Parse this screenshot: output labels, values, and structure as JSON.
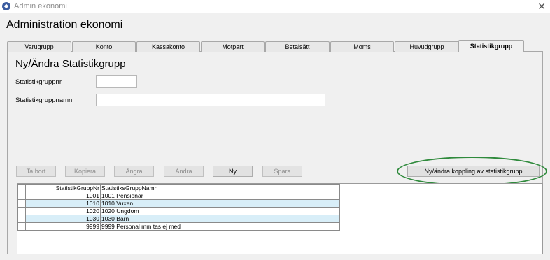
{
  "window": {
    "title": "Admin ekonomi",
    "close_symbol": "✕",
    "app_icon": "app-logo-icon"
  },
  "header": {
    "title": "Administration ekonomi"
  },
  "tabs": [
    {
      "label": "Varugrupp",
      "active": false
    },
    {
      "label": "Konto",
      "active": false
    },
    {
      "label": "Kassakonto",
      "active": false
    },
    {
      "label": "Motpart",
      "active": false
    },
    {
      "label": "Betalsätt",
      "active": false
    },
    {
      "label": "Moms",
      "active": false
    },
    {
      "label": "Huvudgrupp",
      "active": false
    },
    {
      "label": "Statistikgrupp",
      "active": true
    }
  ],
  "form": {
    "title": "Ny/Ändra Statistikgrupp",
    "nr_label": "Statistikgruppnr",
    "nr_value": "",
    "name_label": "Statistikgruppnamn",
    "name_value": ""
  },
  "buttons": {
    "delete": "Ta bort",
    "copy": "Kopiera",
    "undo": "Ångra",
    "edit": "Ändra",
    "new": "Ny",
    "save": "Spara",
    "link": "Ny/ändra koppling av statistikgrupp"
  },
  "annotation": {
    "color": "#2f8a3c"
  },
  "grid": {
    "columns": [
      "StatistikGruppNr",
      "StatistiksGruppNamn"
    ],
    "rows": [
      {
        "nr": "1001",
        "name": "1001 Pensionär"
      },
      {
        "nr": "1010",
        "name": "1010 Vuxen"
      },
      {
        "nr": "1020",
        "name": "1020 Ungdom"
      },
      {
        "nr": "1030",
        "name": "1030 Barn"
      },
      {
        "nr": "9999",
        "name": "9999 Personal mm tas ej med"
      }
    ],
    "alt_row_color": "#d8eef8"
  }
}
